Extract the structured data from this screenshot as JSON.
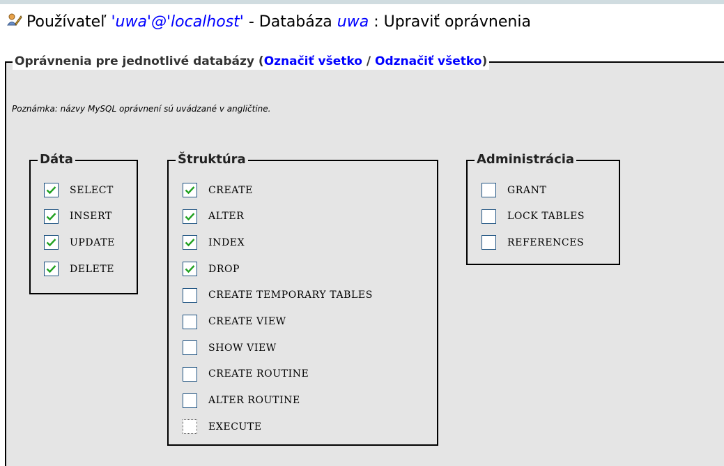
{
  "header": {
    "prefix": "Používateľ",
    "user": "'uwa'@'localhost'",
    "db_label": "- Databáza",
    "db_name": "uwa",
    "suffix": ": Upraviť oprávnenia"
  },
  "db_privileges": {
    "legend_prefix": "Oprávnenia pre jednotlivé databázy (",
    "check_all": "Označiť všetko",
    "separator": "/",
    "uncheck_all": "Odznačiť všetko",
    "legend_suffix": ")",
    "note": "Poznámka: názvy MySQL oprávnení sú uvádzané v angličtine."
  },
  "groups": [
    {
      "legend": "Dáta",
      "items": [
        {
          "label": "SELECT",
          "checked": true
        },
        {
          "label": "INSERT",
          "checked": true
        },
        {
          "label": "UPDATE",
          "checked": true
        },
        {
          "label": "DELETE",
          "checked": true
        }
      ]
    },
    {
      "legend": "Štruktúra",
      "items": [
        {
          "label": "CREATE",
          "checked": true
        },
        {
          "label": "ALTER",
          "checked": true
        },
        {
          "label": "INDEX",
          "checked": true
        },
        {
          "label": "DROP",
          "checked": true
        },
        {
          "label": "CREATE TEMPORARY TABLES",
          "checked": false
        },
        {
          "label": "CREATE VIEW",
          "checked": false
        },
        {
          "label": "SHOW VIEW",
          "checked": false
        },
        {
          "label": "CREATE ROUTINE",
          "checked": false
        },
        {
          "label": "ALTER ROUTINE",
          "checked": false
        },
        {
          "label": "EXECUTE",
          "checked": false,
          "focused": true
        }
      ]
    },
    {
      "legend": "Administrácia",
      "items": [
        {
          "label": "GRANT",
          "checked": false
        },
        {
          "label": "LOCK TABLES",
          "checked": false
        },
        {
          "label": "REFERENCES",
          "checked": false
        }
      ]
    }
  ],
  "colors": {
    "link": "#0000ff",
    "check": "#21a121",
    "panel": "#e5e5e5"
  },
  "icons": {
    "header": "user-edit-icon",
    "checkbox": "checkmark-icon"
  }
}
